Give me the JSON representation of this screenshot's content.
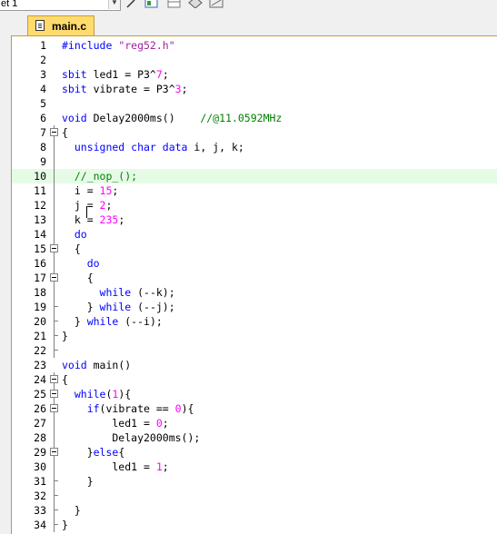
{
  "toolbar": {
    "target_text": "et 1",
    "icons": [
      "dropdown-arrow",
      "magic-wand-icon",
      "window-icon",
      "layout-icon",
      "diamond-icon",
      "tools-icon"
    ]
  },
  "tab": {
    "label": "main.c",
    "active_color": "#ffdb6e"
  },
  "editor": {
    "current_line": 10,
    "lines": [
      {
        "n": "1",
        "segs": [
          {
            "t": "#include ",
            "c": "kw"
          },
          {
            "t": "\"reg52.h\"",
            "c": "str"
          }
        ]
      },
      {
        "n": "2",
        "segs": []
      },
      {
        "n": "3",
        "segs": [
          {
            "t": "sbit ",
            "c": "kw"
          },
          {
            "t": "led1 = P3^",
            "c": "op"
          },
          {
            "t": "7",
            "c": "num"
          },
          {
            "t": ";",
            "c": "op"
          }
        ]
      },
      {
        "n": "4",
        "segs": [
          {
            "t": "sbit ",
            "c": "kw"
          },
          {
            "t": "vibrate = P3^",
            "c": "op"
          },
          {
            "t": "3",
            "c": "num"
          },
          {
            "t": ";",
            "c": "op"
          }
        ]
      },
      {
        "n": "5",
        "segs": []
      },
      {
        "n": "6",
        "segs": [
          {
            "t": "void ",
            "c": "kw"
          },
          {
            "t": "Delay2000ms()    ",
            "c": "op"
          },
          {
            "t": "//@11.0592MHz",
            "c": "cmt"
          }
        ]
      },
      {
        "n": "7",
        "fold": "open",
        "segs": [
          {
            "t": "{",
            "c": "op"
          }
        ]
      },
      {
        "n": "8",
        "fold": "line",
        "segs": [
          {
            "t": "  unsigned char data ",
            "c": "kw"
          },
          {
            "t": "i, j, k;",
            "c": "op"
          }
        ]
      },
      {
        "n": "9",
        "fold": "line",
        "segs": []
      },
      {
        "n": "10",
        "fold": "line",
        "segs": [
          {
            "t": "  //_nop_();",
            "c": "cmt"
          }
        ]
      },
      {
        "n": "11",
        "fold": "line",
        "segs": [
          {
            "t": "  i = ",
            "c": "op"
          },
          {
            "t": "15",
            "c": "num"
          },
          {
            "t": ";",
            "c": "op"
          }
        ]
      },
      {
        "n": "12",
        "fold": "line",
        "segs": [
          {
            "t": "  j = ",
            "c": "op"
          },
          {
            "t": "2",
            "c": "num"
          },
          {
            "t": ";",
            "c": "op"
          }
        ]
      },
      {
        "n": "13",
        "fold": "line",
        "segs": [
          {
            "t": "  k = ",
            "c": "op"
          },
          {
            "t": "235",
            "c": "num"
          },
          {
            "t": ";",
            "c": "op"
          }
        ]
      },
      {
        "n": "14",
        "fold": "line",
        "segs": [
          {
            "t": "  do",
            "c": "kw"
          }
        ]
      },
      {
        "n": "15",
        "fold": "open",
        "segs": [
          {
            "t": "  {",
            "c": "op"
          }
        ]
      },
      {
        "n": "16",
        "fold": "line",
        "segs": [
          {
            "t": "    do",
            "c": "kw"
          }
        ]
      },
      {
        "n": "17",
        "fold": "open",
        "segs": [
          {
            "t": "    {",
            "c": "op"
          }
        ]
      },
      {
        "n": "18",
        "fold": "line",
        "segs": [
          {
            "t": "      while ",
            "c": "kw"
          },
          {
            "t": "(--k);",
            "c": "op"
          }
        ]
      },
      {
        "n": "19",
        "fold": "end",
        "segs": [
          {
            "t": "    } ",
            "c": "op"
          },
          {
            "t": "while ",
            "c": "kw"
          },
          {
            "t": "(--j);",
            "c": "op"
          }
        ]
      },
      {
        "n": "20",
        "fold": "end",
        "segs": [
          {
            "t": "  } ",
            "c": "op"
          },
          {
            "t": "while ",
            "c": "kw"
          },
          {
            "t": "(--i);",
            "c": "op"
          }
        ]
      },
      {
        "n": "21",
        "fold": "end",
        "segs": [
          {
            "t": "}",
            "c": "op"
          }
        ]
      },
      {
        "n": "22",
        "fold": "end",
        "segs": []
      },
      {
        "n": "23",
        "segs": [
          {
            "t": "void ",
            "c": "kw"
          },
          {
            "t": "main()",
            "c": "op"
          }
        ]
      },
      {
        "n": "24",
        "fold": "open",
        "segs": [
          {
            "t": "{",
            "c": "op"
          }
        ]
      },
      {
        "n": "25",
        "fold": "open",
        "segs": [
          {
            "t": "  while",
            "c": "kw"
          },
          {
            "t": "(",
            "c": "op"
          },
          {
            "t": "1",
            "c": "num"
          },
          {
            "t": "){",
            "c": "op"
          }
        ]
      },
      {
        "n": "26",
        "fold": "open",
        "segs": [
          {
            "t": "    if",
            "c": "kw"
          },
          {
            "t": "(vibrate == ",
            "c": "op"
          },
          {
            "t": "0",
            "c": "num"
          },
          {
            "t": "){",
            "c": "op"
          }
        ]
      },
      {
        "n": "27",
        "fold": "line",
        "segs": [
          {
            "t": "        led1 = ",
            "c": "op"
          },
          {
            "t": "0",
            "c": "num"
          },
          {
            "t": ";",
            "c": "op"
          }
        ]
      },
      {
        "n": "28",
        "fold": "line",
        "segs": [
          {
            "t": "        Delay2000ms();",
            "c": "op"
          }
        ]
      },
      {
        "n": "29",
        "fold": "open",
        "segs": [
          {
            "t": "    }",
            "c": "op"
          },
          {
            "t": "else",
            "c": "kw"
          },
          {
            "t": "{",
            "c": "op"
          }
        ]
      },
      {
        "n": "30",
        "fold": "line",
        "segs": [
          {
            "t": "        led1 = ",
            "c": "op"
          },
          {
            "t": "1",
            "c": "num"
          },
          {
            "t": ";",
            "c": "op"
          }
        ]
      },
      {
        "n": "31",
        "fold": "end",
        "segs": [
          {
            "t": "    }",
            "c": "op"
          }
        ]
      },
      {
        "n": "32",
        "fold": "end",
        "segs": []
      },
      {
        "n": "33",
        "fold": "end",
        "segs": [
          {
            "t": "  }",
            "c": "op"
          }
        ]
      },
      {
        "n": "34",
        "fold": "end",
        "segs": [
          {
            "t": "}",
            "c": "op"
          }
        ]
      }
    ]
  }
}
